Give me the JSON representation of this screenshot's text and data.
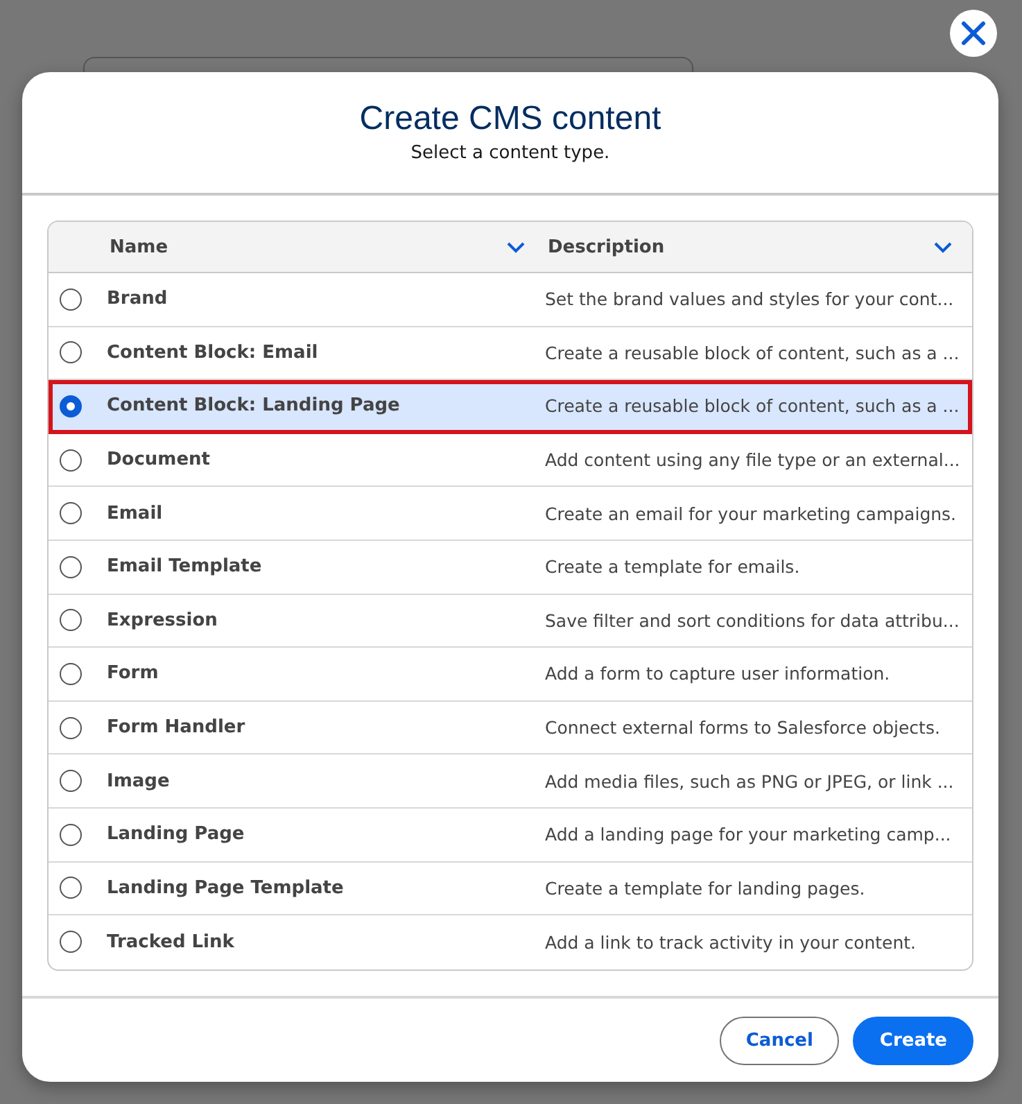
{
  "dialog": {
    "title": "Create CMS content",
    "subtitle": "Select a content type."
  },
  "table": {
    "columns": [
      "Name",
      "Description"
    ],
    "rows": [
      {
        "name": "Brand",
        "description": "Set the brand values and styles for your cont...",
        "selected": false
      },
      {
        "name": "Content Block: Email",
        "description": "Create a reusable block of content, such as a ...",
        "selected": false
      },
      {
        "name": "Content Block: Landing Page",
        "description": "Create a reusable block of content, such as a ...",
        "selected": true
      },
      {
        "name": "Document",
        "description": "Add content using any file type or an external...",
        "selected": false
      },
      {
        "name": "Email",
        "description": "Create an email for your marketing campaigns.",
        "selected": false
      },
      {
        "name": "Email Template",
        "description": "Create a template for emails.",
        "selected": false
      },
      {
        "name": "Expression",
        "description": "Save filter and sort conditions for data attribu...",
        "selected": false
      },
      {
        "name": "Form",
        "description": "Add a form to capture user information.",
        "selected": false
      },
      {
        "name": "Form Handler",
        "description": "Connect external forms to Salesforce objects.",
        "selected": false
      },
      {
        "name": "Image",
        "description": "Add media files, such as PNG or JPEG, or link ...",
        "selected": false
      },
      {
        "name": "Landing Page",
        "description": "Add a landing page for your marketing camp...",
        "selected": false
      },
      {
        "name": "Landing Page Template",
        "description": "Create a template for landing pages.",
        "selected": false
      },
      {
        "name": "Tracked Link",
        "description": "Add a link to track activity in your content.",
        "selected": false
      }
    ]
  },
  "buttons": [
    "Cancel",
    "Create"
  ]
}
